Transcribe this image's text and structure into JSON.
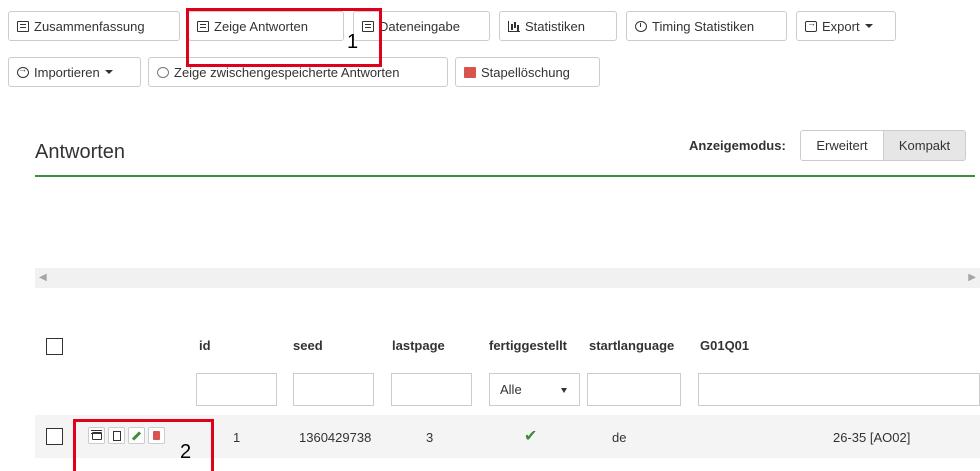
{
  "toolbar": {
    "summary": "Zusammenfassung",
    "show_responses": "Zeige Antworten",
    "data_entry": "Dateneingabe",
    "statistics": "Statistiken",
    "timing_statistics": "Timing Statistiken",
    "export": "Export",
    "import": "Importieren",
    "show_saved": "Zeige zwischengespeicherte Antworten",
    "batch_delete": "Stapellöschung"
  },
  "annotations": {
    "marker1": "1",
    "marker2": "2"
  },
  "panel": {
    "title": "Antworten",
    "display_mode_label": "Anzeigemodus:",
    "mode_extended": "Erweitert",
    "mode_compact": "Kompakt"
  },
  "table": {
    "columns": [
      "id",
      "seed",
      "lastpage",
      "fertiggestellt",
      "startlanguage",
      "G01Q01"
    ],
    "filter_select": "Alle",
    "rows": [
      {
        "id": "1",
        "seed": "1360429738",
        "lastpage": "3",
        "completed": "✔",
        "startlanguage": "de",
        "G01Q01": "26-35 [AO02]"
      }
    ]
  },
  "colors": {
    "accent_green": "#3c8d3c",
    "annotation_red": "#e0001b",
    "delete_red": "#d9534f"
  }
}
